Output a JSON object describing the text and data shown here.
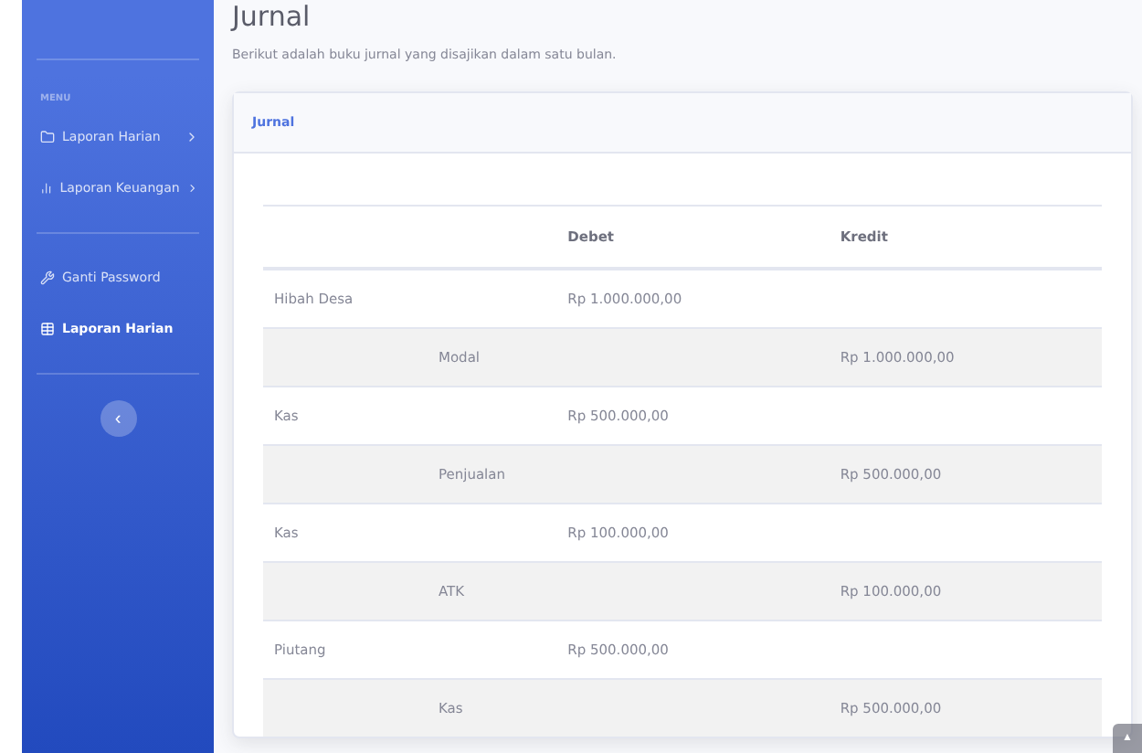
{
  "sidebar": {
    "heading": "MENU",
    "groups": [
      [
        {
          "label": "Laporan Harian",
          "expandable": true,
          "selected": false
        },
        {
          "label": "Laporan Keuangan",
          "expandable": true,
          "selected": false
        }
      ],
      [
        {
          "label": "Ganti Password",
          "expandable": false,
          "selected": false
        },
        {
          "label": "Laporan Harian",
          "expandable": false,
          "selected": true
        }
      ]
    ],
    "toggle": "‹"
  },
  "page": {
    "title": "Jurnal",
    "subtitle": "Berikut adalah buku jurnal yang disajikan dalam satu bulan."
  },
  "card": {
    "title": "Jurnal",
    "columns": [
      "Debet",
      "Kredit"
    ],
    "rows": [
      {
        "kind": "debit",
        "account": "Hibah Desa",
        "amount": "Rp 1.000.000,00"
      },
      {
        "kind": "credit",
        "account": "Modal",
        "amount": "Rp 1.000.000,00"
      },
      {
        "kind": "debit",
        "account": "Kas",
        "amount": "Rp 500.000,00"
      },
      {
        "kind": "credit",
        "account": "Penjualan",
        "amount": "Rp 500.000,00"
      },
      {
        "kind": "debit",
        "account": "Kas",
        "amount": "Rp 100.000,00"
      },
      {
        "kind": "credit",
        "account": "ATK",
        "amount": "Rp 100.000,00"
      },
      {
        "kind": "debit",
        "account": "Piutang",
        "amount": "Rp 500.000,00"
      },
      {
        "kind": "credit",
        "account": "Kas",
        "amount": "Rp 500.000,00"
      }
    ]
  },
  "scroll_top": "▲"
}
